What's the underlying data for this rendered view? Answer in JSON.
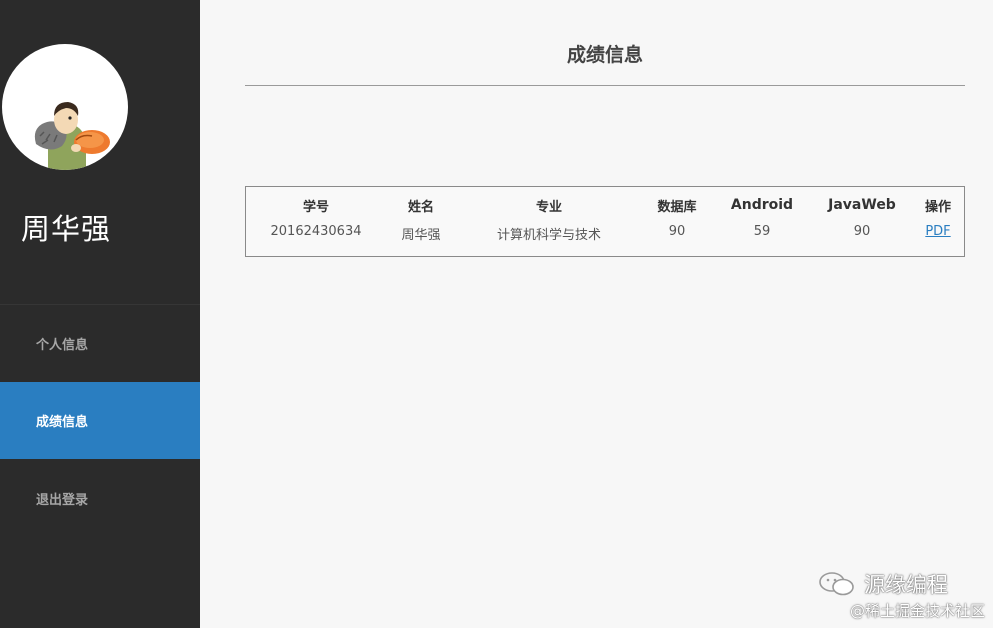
{
  "sidebar": {
    "user_name": "周华强",
    "nav": [
      {
        "label": "个人信息",
        "active": false
      },
      {
        "label": "成绩信息",
        "active": true
      },
      {
        "label": "退出登录",
        "active": false
      }
    ]
  },
  "main": {
    "title": "成绩信息",
    "table": {
      "headers": [
        "学号",
        "姓名",
        "专业",
        "数据库",
        "Android",
        "JavaWeb",
        "操作"
      ],
      "rows": [
        [
          "20162430634",
          "周华强",
          "计算机科学与技术",
          "90",
          "59",
          "90",
          "PDF"
        ]
      ]
    }
  },
  "watermark": {
    "brand": "源缘编程",
    "site": "@稀土掘金技术社区"
  },
  "colors": {
    "sidebar_bg": "#2b2b2b",
    "active_nav": "#2a7ec1",
    "page_bg": "#f7f7f7"
  }
}
